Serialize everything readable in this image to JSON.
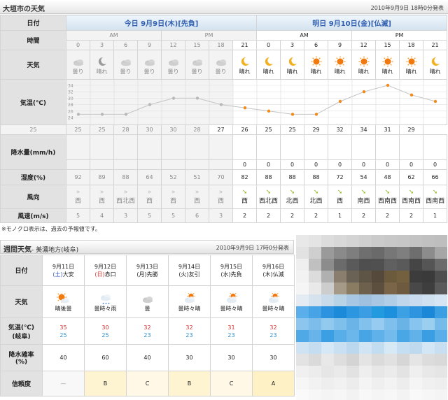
{
  "header": {
    "title": "大垣市の天気",
    "issued": "2010年9月9日 18時0分発表"
  },
  "daily": {
    "labels": {
      "date": "日付",
      "time": "時間",
      "weather": "天気",
      "temp": "気温(℃)",
      "rain": "降水量(mm/h)",
      "humidity": "湿度(%)",
      "wind_dir": "風向",
      "wind_speed": "風速(m/s)"
    },
    "today_header": "今日 9月9日(木)[先負]",
    "tomorrow_header": "明日 9月10日(金)[仏滅]",
    "am": "AM",
    "pm": "PM",
    "hours": [
      "0",
      "3",
      "6",
      "9",
      "12",
      "15",
      "18",
      "21",
      "0",
      "3",
      "6",
      "9",
      "12",
      "15",
      "18",
      "21"
    ],
    "past_count": 7,
    "weather": [
      "曇り",
      "晴れ",
      "曇り",
      "曇り",
      "曇り",
      "曇り",
      "曇り",
      "晴れ",
      "晴れ",
      "晴れ",
      "晴れ",
      "晴れ",
      "晴れ",
      "晴れ",
      "晴れ",
      "晴れ"
    ],
    "weather_icons": [
      "cloud-icon",
      "moon-icon",
      "cloud-icon",
      "cloud-icon",
      "cloud-icon",
      "cloud-icon",
      "cloud-icon",
      "moon-icon",
      "moon-icon",
      "moon-icon",
      "sun-icon",
      "sun-icon",
      "sun-icon",
      "sun-icon",
      "sun-icon",
      "moon-icon"
    ],
    "temps": [
      "25",
      "25",
      "25",
      "28",
      "30",
      "30",
      "28",
      "27",
      "26",
      "25",
      "25",
      "29",
      "32",
      "34",
      "31",
      "29"
    ],
    "rain": [
      "",
      "",
      "",
      "",
      "",
      "",
      "",
      "0",
      "0",
      "0",
      "0",
      "0",
      "0",
      "0",
      "0",
      "0"
    ],
    "humidity": [
      "92",
      "89",
      "88",
      "64",
      "52",
      "51",
      "70",
      "82",
      "88",
      "88",
      "88",
      "72",
      "54",
      "48",
      "62",
      "66"
    ],
    "wind_dir": [
      "西",
      "西",
      "西北西",
      "西",
      "西",
      "西",
      "西",
      "西",
      "西北西",
      "北西",
      "北西",
      "西",
      "南西",
      "西南西",
      "西南西",
      "西南西"
    ],
    "wind_speed": [
      "5",
      "4",
      "3",
      "5",
      "5",
      "6",
      "3",
      "2",
      "2",
      "2",
      "2",
      "1",
      "2",
      "2",
      "2",
      "1"
    ]
  },
  "chart_data": {
    "type": "line",
    "x": [
      "0",
      "3",
      "6",
      "9",
      "12",
      "15",
      "18",
      "21",
      "0",
      "3",
      "6",
      "9",
      "12",
      "15",
      "18",
      "21"
    ],
    "y_ticks": [
      "34",
      "32",
      "30",
      "28",
      "26",
      "24"
    ],
    "ylim": [
      24,
      34
    ],
    "values": [
      25,
      25,
      25,
      28,
      30,
      30,
      28,
      27,
      26,
      25,
      25,
      29,
      32,
      34,
      31,
      29
    ],
    "past_color": "#b8b8b8",
    "future_color": "#f08a1a"
  },
  "note": "※モノクロ表示は、過去の予報値です。",
  "weekly": {
    "title": "週間天気",
    "subtitle": "- 美濃地方(岐阜)",
    "issued": "2010年9月9日 17時0分発表",
    "labels": {
      "date": "日付",
      "weather": "天気",
      "temp_line1": "気温(℃)",
      "temp_line2": "(岐阜)",
      "rain_line1": "降水確率",
      "rain_line2": "(%)",
      "reliability": "信頼度"
    },
    "days": [
      {
        "date": "9月11日",
        "dow": "(土)",
        "rokuyo": "大安",
        "dow_type": "sat",
        "weather": "晴後曇",
        "icon": "sun-cloud-icon",
        "hi": "35",
        "lo": "25",
        "rain": "40",
        "rel": "—"
      },
      {
        "date": "9月12日",
        "dow": "(日)",
        "rokuyo": "赤口",
        "dow_type": "sun",
        "weather": "曇時々雨",
        "icon": "cloud-rain-icon",
        "hi": "30",
        "lo": "25",
        "rain": "60",
        "rel": "B"
      },
      {
        "date": "9月13日",
        "dow": "(月)",
        "rokuyo": "先勝",
        "dow_type": "",
        "weather": "曇",
        "icon": "cloud-icon",
        "hi": "32",
        "lo": "23",
        "rain": "40",
        "rel": "C"
      },
      {
        "date": "9月14日",
        "dow": "(火)",
        "rokuyo": "友引",
        "dow_type": "",
        "weather": "曇時々晴",
        "icon": "cloud-sun-icon",
        "hi": "32",
        "lo": "23",
        "rain": "30",
        "rel": "B"
      },
      {
        "date": "9月15日",
        "dow": "(水)",
        "rokuyo": "先負",
        "dow_type": "",
        "weather": "曇時々晴",
        "icon": "cloud-sun-icon",
        "hi": "31",
        "lo": "23",
        "rain": "30",
        "rel": "C"
      },
      {
        "date": "9月16日",
        "dow": "(木)",
        "rokuyo": "仏滅",
        "dow_type": "",
        "weather": "曇時々晴",
        "icon": "cloud-sun-icon",
        "hi": "32",
        "lo": "23",
        "rain": "30",
        "rel": "A"
      }
    ]
  }
}
